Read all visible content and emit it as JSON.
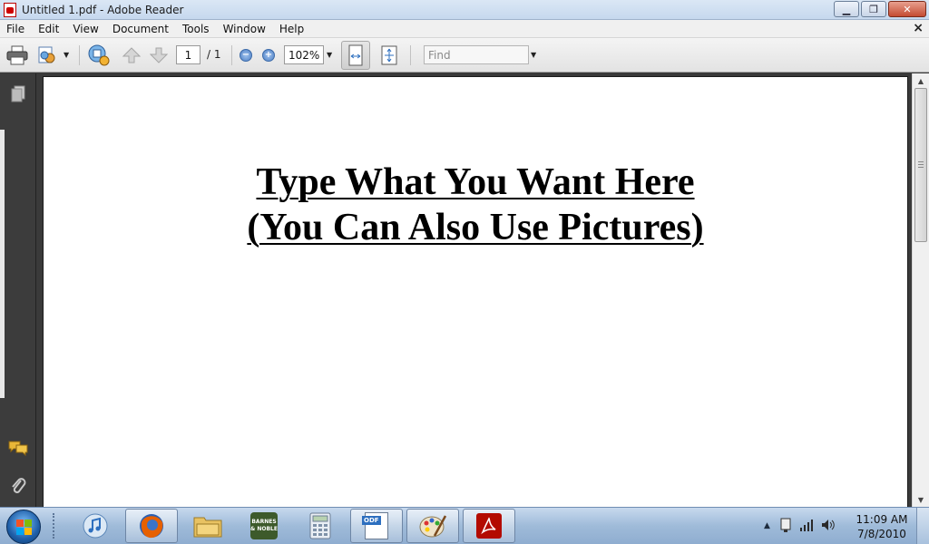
{
  "window": {
    "title": "Untitled 1.pdf - Adobe Reader",
    "minimize_label": "▁",
    "restore_label": "❐",
    "close_label": "✕"
  },
  "menu": {
    "items": [
      "File",
      "Edit",
      "View",
      "Document",
      "Tools",
      "Window",
      "Help"
    ],
    "close_label": "×"
  },
  "toolbar": {
    "current_page": "1",
    "page_total": "/ 1",
    "zoom_value": "102%",
    "find_placeholder": "Find"
  },
  "document": {
    "line1": "Type What You Want Here",
    "line2": "(You Can Also Use Pictures)"
  },
  "taskbar": {
    "clock_time": "11:09 AM",
    "clock_date": "7/8/2010",
    "apps": [
      "itunes-icon",
      "firefox-icon",
      "file-explorer-icon",
      "barnes-noble-icon",
      "calculator-icon",
      "odf-document-icon",
      "paint-icon",
      "adobe-reader-icon"
    ],
    "barnes_noble_label": "BARNES & NOBLE",
    "odf_label": "ODF"
  },
  "colors": {
    "acrobat_red": "#b30b00",
    "taskbar_blue": "#9fbbd9",
    "page_bg": "#ffffff",
    "workspace_bg": "#3a3a3a"
  }
}
